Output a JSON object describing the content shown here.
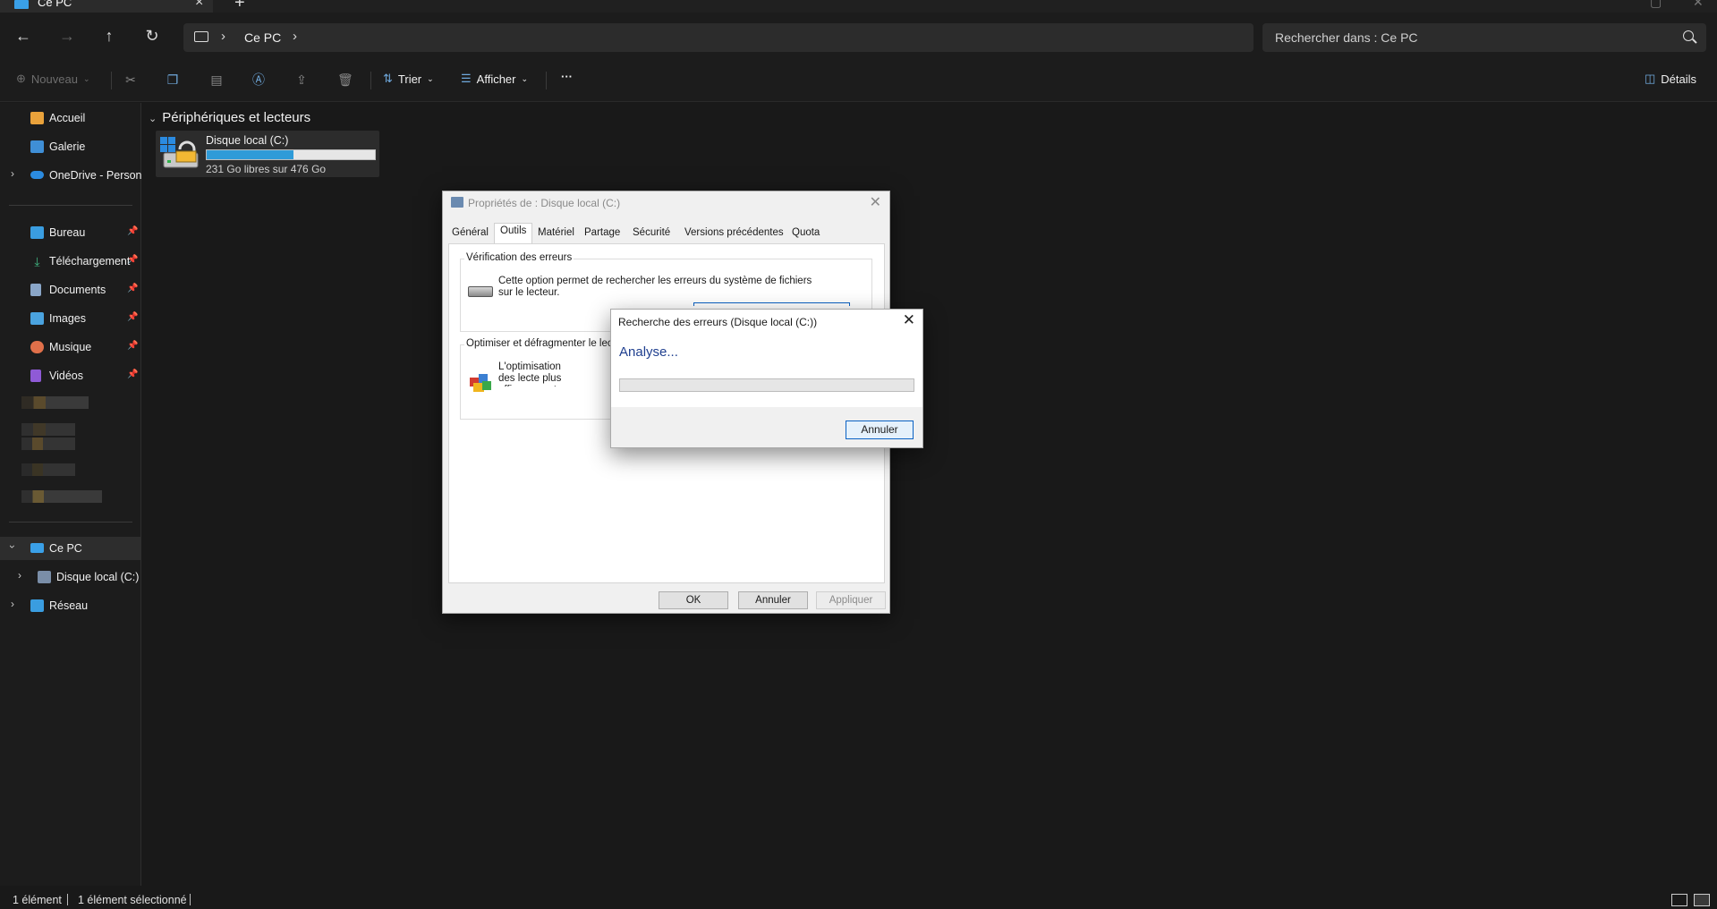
{
  "titlebar": {
    "tab_title": "Ce PC",
    "new_tab": "+"
  },
  "nav": {
    "back": "←",
    "forward": "→",
    "up": "↑",
    "refresh": "↻",
    "chevron": "›",
    "breadcrumb": "Ce PC",
    "search_placeholder": "Rechercher dans : Ce PC"
  },
  "toolbar": {
    "new_label": "Nouveau",
    "sort_label": "Trier",
    "view_label": "Afficher",
    "more": "···",
    "details_label": "Détails"
  },
  "sidebar": {
    "home": "Accueil",
    "gallery": "Galerie",
    "onedrive": "OneDrive - Persona",
    "quick": [
      {
        "label": "Bureau",
        "color": "#3a9de0"
      },
      {
        "label": "Téléchargement",
        "color": "#3fb37f"
      },
      {
        "label": "Documents",
        "color": "#8aa6c8"
      },
      {
        "label": "Images",
        "color": "#4aa3df"
      },
      {
        "label": "Musique",
        "color": "#e0704a"
      },
      {
        "label": "Vidéos",
        "color": "#8f5ad6"
      }
    ],
    "this_pc": "Ce PC",
    "local_disk": "Disque local (C:)",
    "network": "Réseau"
  },
  "content": {
    "group_title": "Périphériques et lecteurs",
    "drive_name": "Disque local (C:)",
    "drive_free": "231 Go libres sur 476 Go",
    "drive_used_fraction": 0.515
  },
  "status": {
    "count": "1 élément",
    "selected": "1 élément sélectionné"
  },
  "properties_dialog": {
    "title": "Propriétés de : Disque local (C:)",
    "tabs": [
      "Général",
      "Outils",
      "Matériel",
      "Partage",
      "Sécurité",
      "Versions précédentes",
      "Quota"
    ],
    "active_tab": "Outils",
    "error_check_title": "Vérification des erreurs",
    "error_check_text": "Cette option permet de rechercher les erreurs du système de fichiers sur le lecteur.",
    "optimize_title": "Optimiser et défragmenter le lecteur",
    "optimize_text": "L'optimisation des lecte plus efficacement.",
    "ok": "OK",
    "cancel": "Annuler",
    "apply": "Appliquer"
  },
  "check_dialog": {
    "title": "Recherche des erreurs (Disque local (C:))",
    "status": "Analyse...",
    "progress_fraction": 0.0,
    "cancel": "Annuler"
  }
}
